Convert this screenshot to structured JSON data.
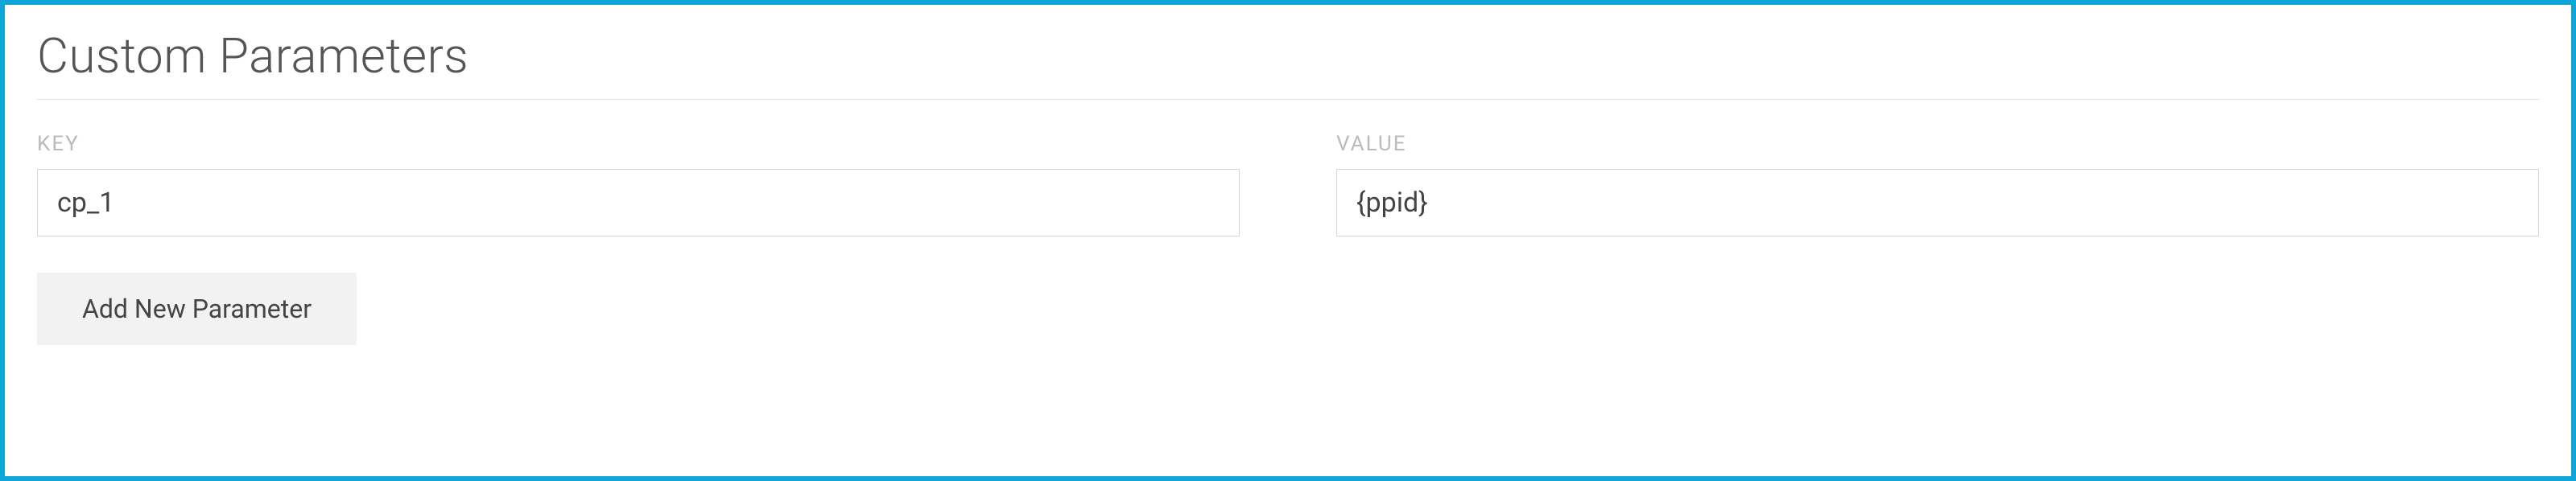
{
  "section": {
    "title": "Custom Parameters"
  },
  "labels": {
    "key": "KEY",
    "value": "VALUE"
  },
  "parameters": [
    {
      "key": "cp_1",
      "value": "{ppid}"
    }
  ],
  "buttons": {
    "add": "Add New Parameter"
  },
  "colors": {
    "border": "#0ea5d9",
    "text": "#555555",
    "label": "#bbbbbb",
    "input_border": "#d6d6d6",
    "button_bg": "#f2f2f2"
  }
}
